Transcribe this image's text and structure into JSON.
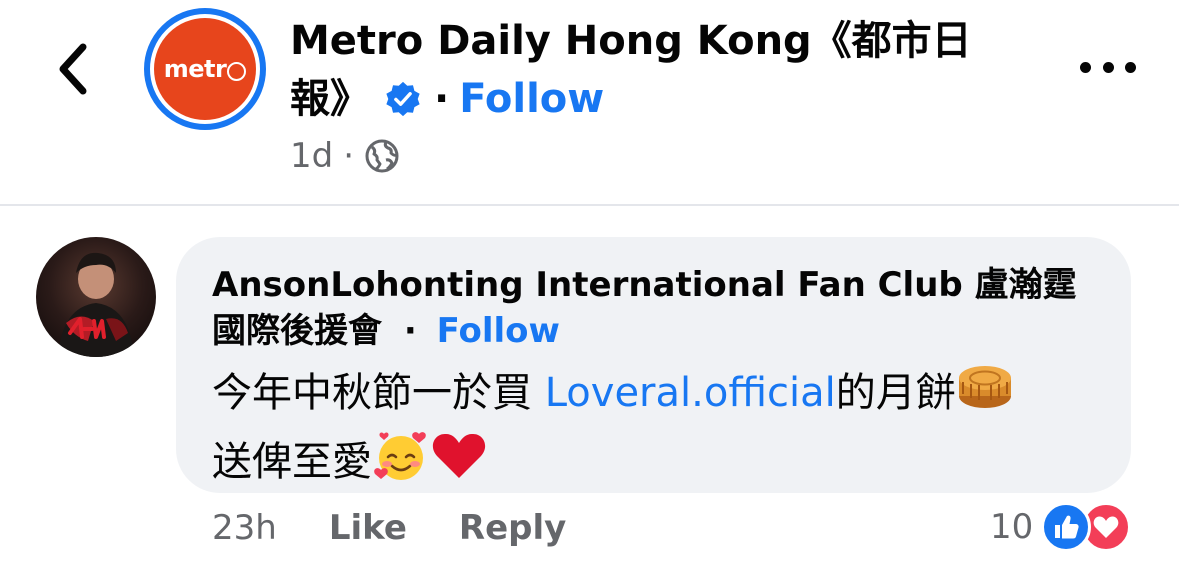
{
  "post_header": {
    "page_name_line1": "Metro Daily Hong Kong《都市日",
    "page_name_line2": "報》",
    "avatar_text": "metr",
    "separator": "·",
    "follow_label": "Follow",
    "time": "1d",
    "meta_separator": "·",
    "privacy_icon": "globe-icon"
  },
  "comment": {
    "author_line1": "AnsonLohonting International Fan Club 盧瀚霆",
    "author_line2": "國際後援會",
    "separator": "·",
    "follow_label": "Follow",
    "text_part1": "今年中秋節一於買 ",
    "mention": "Loveral.official",
    "text_part2": "的月餅",
    "text_part3": "送俾至愛",
    "time": "23h",
    "like_label": "Like",
    "reply_label": "Reply",
    "reaction_count": "10",
    "reactions": [
      "like",
      "love"
    ]
  },
  "colors": {
    "brand_blue": "#1877f2",
    "metro_red": "#e7451c",
    "love_red": "#f33e58",
    "bubble_bg": "#f0f2f5",
    "secondary_text": "#65676b"
  }
}
